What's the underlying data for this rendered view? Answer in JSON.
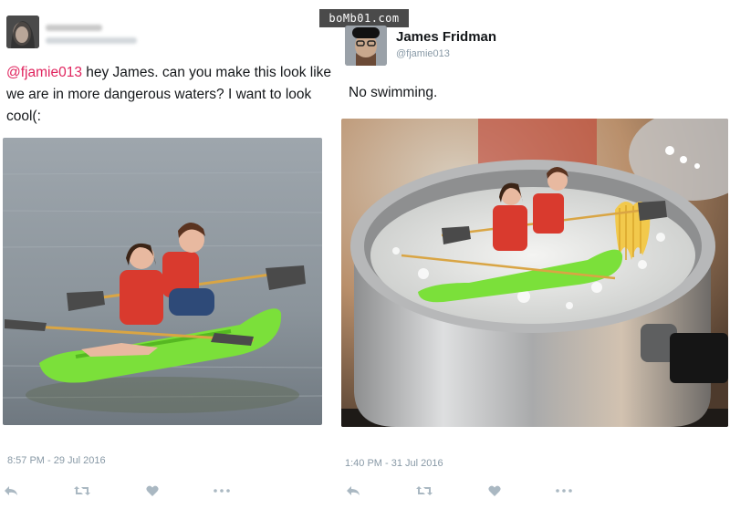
{
  "watermark": "boMb01.com",
  "left_tweet": {
    "mention": "@fjamie013",
    "body": " hey James. can you make this look like we are in more dangerous waters? I want to look cool(:",
    "timestamp": "8:57 PM - 29 Jul 2016"
  },
  "right_tweet": {
    "display_name": "James Fridman",
    "handle": "@fjamie013",
    "body": "No swimming.",
    "timestamp": "1:40 PM - 31 Jul 2016"
  },
  "actions": {
    "reply_icon": "reply-icon",
    "retweet_icon": "retweet-icon",
    "like_icon": "heart-icon",
    "more_icon": "more-icon"
  },
  "colors": {
    "mention": "#e0245e",
    "meta_gray": "#8899a6",
    "icon_gray": "#aab8c2",
    "kayak_green": "#7be03a"
  }
}
